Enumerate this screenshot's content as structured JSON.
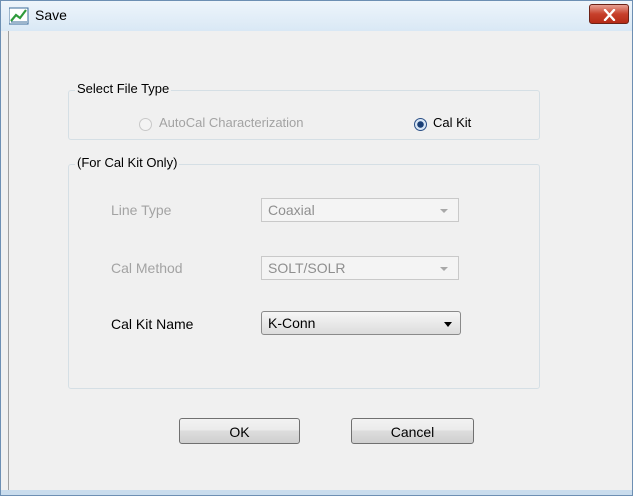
{
  "window": {
    "title": "Save",
    "app_icon": "graph-icon",
    "close_icon": "close-icon"
  },
  "file_type": {
    "label": "Select File Type",
    "options": [
      {
        "label": "AutoCal Characterization",
        "enabled": false,
        "checked": false
      },
      {
        "label": "Cal Kit",
        "enabled": true,
        "checked": true
      }
    ]
  },
  "cal_kit_group": {
    "label": "(For Cal Kit Only)",
    "fields": [
      {
        "label": "Line Type",
        "value": "Coaxial",
        "enabled": false
      },
      {
        "label": "Cal Method",
        "value": "SOLT/SOLR",
        "enabled": false
      },
      {
        "label": "Cal Kit Name",
        "value": "K-Conn",
        "enabled": true
      }
    ]
  },
  "buttons": {
    "ok": "OK",
    "cancel": "Cancel"
  },
  "colors": {
    "title_gradient_top": "#eef5fb",
    "close_red": "#c7402b",
    "face": "#f0f0f0",
    "radio_dot": "#1a3f76"
  }
}
